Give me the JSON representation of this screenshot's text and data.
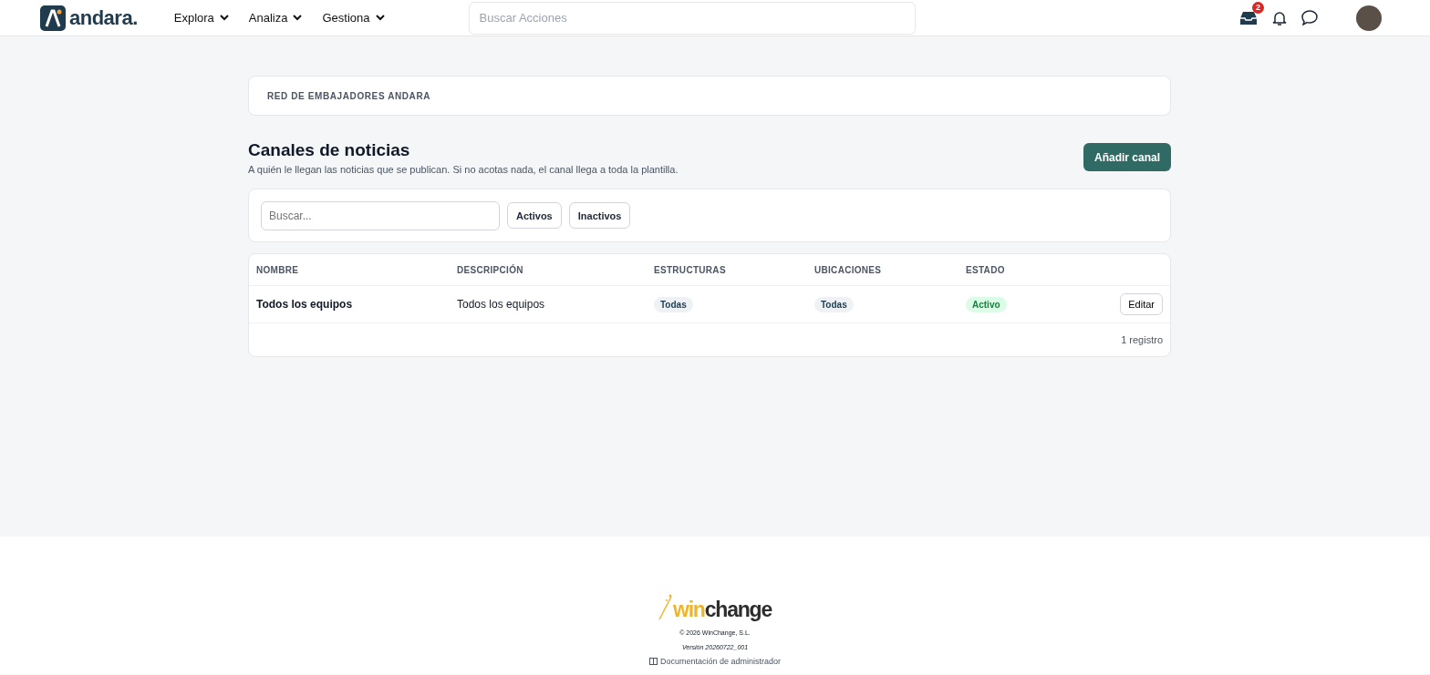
{
  "header": {
    "brand": "andara.",
    "menus": [
      {
        "label": "Explora"
      },
      {
        "label": "Analiza"
      },
      {
        "label": "Gestiona"
      }
    ],
    "search": {
      "placeholder": "Buscar Acciones"
    },
    "inbox_badge": "2"
  },
  "breadcrumb": "RED DE EMBAJADORES ANDARA",
  "page": {
    "title": "Canales de noticias",
    "subtitle": "A quién le llegan las noticias que se publican. Si no acotas nada, el canal llega a toda la plantilla.",
    "add_button": "Añadir canal"
  },
  "filters": {
    "search": {
      "placeholder": "Buscar..."
    },
    "buttons": [
      {
        "label": "Activos",
        "selected": false
      },
      {
        "label": "Inactivos",
        "selected": false
      }
    ]
  },
  "table": {
    "columns": [
      "NOMBRE",
      "DESCRIPCIÓN",
      "ESTRUCTURAS",
      "UBICACIONES",
      "ESTADO"
    ],
    "rows": [
      {
        "name": "Todos los equipos",
        "description": "Todos los equipos",
        "structures": "Todas",
        "locations": "Todas",
        "status": {
          "label": "Activo",
          "active": true
        },
        "action": "Editar"
      }
    ],
    "count": "1 registro"
  },
  "footer": {
    "logo_win": "win",
    "logo_change": "change",
    "copyright": "© 2026 WinChange, S.L.",
    "version": "Versión 20260722_001",
    "doc_link": "Documentación de administrador"
  }
}
